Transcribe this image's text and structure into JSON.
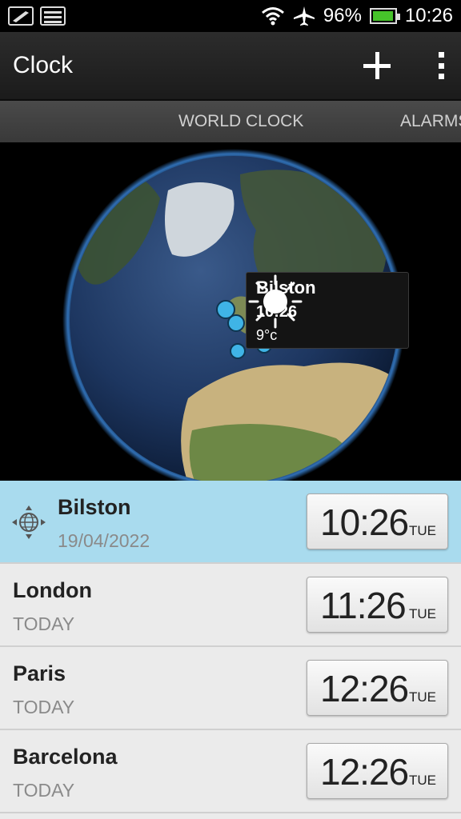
{
  "status_bar": {
    "battery_level": 96,
    "battery_text": "96%",
    "time": "10:26",
    "icons": [
      "notification-icon",
      "image-icon",
      "wifi-icon",
      "airplane-icon",
      "battery-icon"
    ]
  },
  "app": {
    "title": "Clock"
  },
  "actions": {
    "add": "plus-icon",
    "overflow": "overflow-menu-icon"
  },
  "tabs": [
    {
      "label": "WORLD CLOCK",
      "selected": true
    },
    {
      "label": "ALARMS",
      "selected": false
    }
  ],
  "map_callout": {
    "city": "Bilston",
    "time": "10:26",
    "temp": "9°c",
    "weather_icon": "sun-icon"
  },
  "clocks": [
    {
      "city": "Bilston",
      "sub": "19/04/2022",
      "time": "10:26",
      "day": "TUE",
      "current": true
    },
    {
      "city": "London",
      "sub": "TODAY",
      "time": "11:26",
      "day": "TUE",
      "current": false
    },
    {
      "city": "Paris",
      "sub": "TODAY",
      "time": "12:26",
      "day": "TUE",
      "current": false
    },
    {
      "city": "Barcelona",
      "sub": "TODAY",
      "time": "12:26",
      "day": "TUE",
      "current": false
    }
  ],
  "colors": {
    "current_row": "#a9dbee",
    "marker": "#3fb4e6",
    "battery": "#46c32a"
  }
}
